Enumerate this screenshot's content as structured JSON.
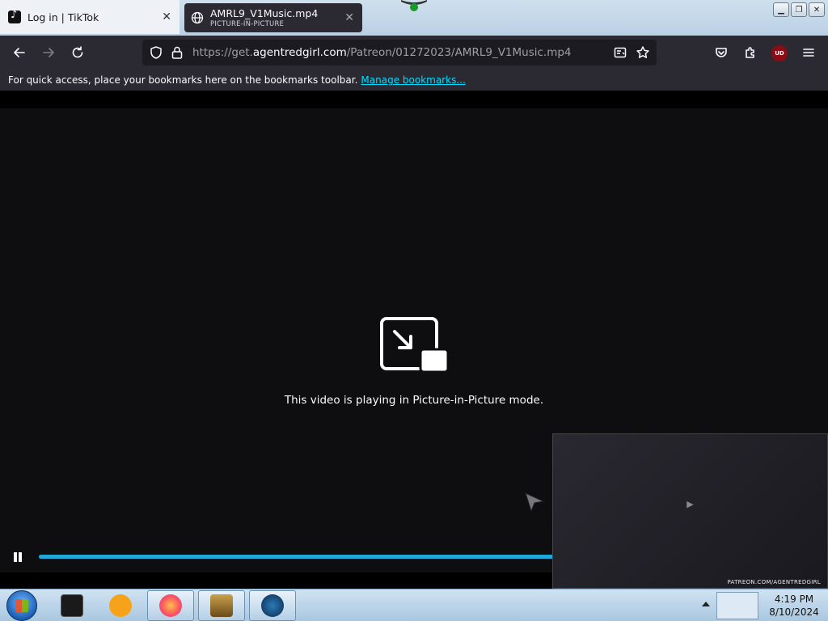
{
  "tabs": [
    {
      "title": "Log in | TikTok"
    },
    {
      "title": "AMRL9_V1Music.mp4",
      "subtitle": "PICTURE-IN-PICTURE"
    }
  ],
  "nav": {
    "url_prefix": "https://get.",
    "url_host": "agentredgirl.com",
    "url_path": "/Patreon/01272023/AMRL9_V1Music.mp4",
    "ublock_label": "UD"
  },
  "bookmarks": {
    "message": "For quick access, place your bookmarks here on the bookmarks toolbar.",
    "manage_link": "Manage bookmarks..."
  },
  "video": {
    "pip_message": "This video is playing in Picture-in-Picture mode.",
    "progress_fraction": 0.665,
    "pip_watermark": "PATREON.COM/AGENTREDGIRL"
  },
  "taskbar": {
    "time": "4:19 PM",
    "date": "8/10/2024"
  },
  "colors": {
    "accent": "#1fa7d8",
    "link": "#00ddff",
    "toolbar": "#2b2a33"
  }
}
